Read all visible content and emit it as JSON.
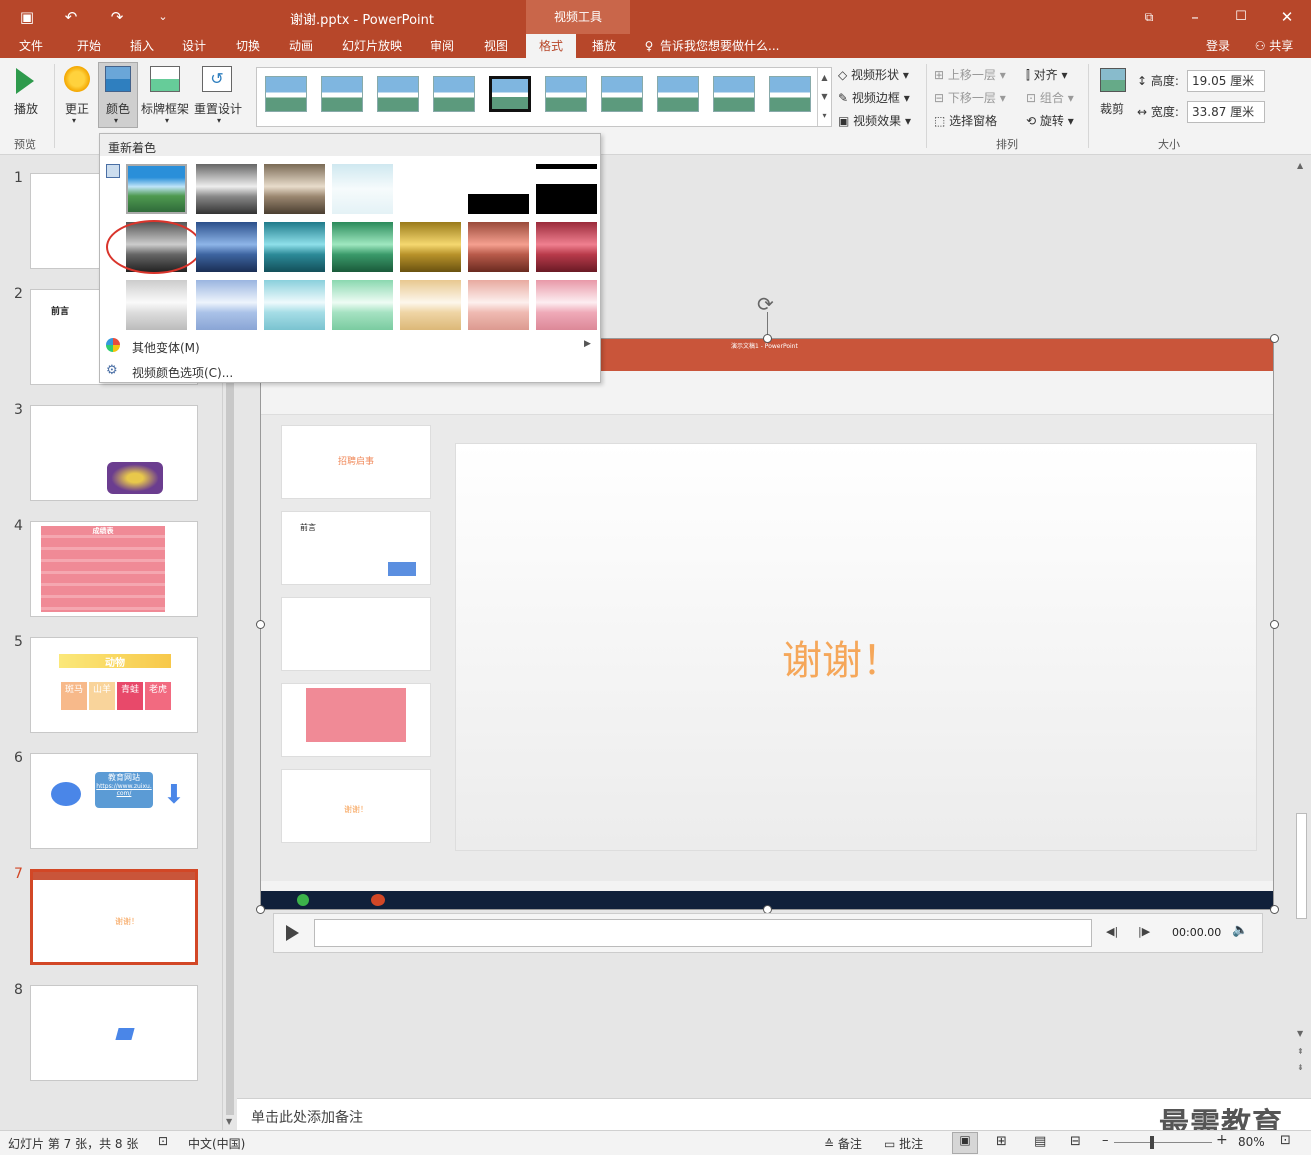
{
  "titlebar": {
    "title": "谢谢.pptx - PowerPoint",
    "context_tab": "视频工具",
    "login": "登录",
    "share": "共享"
  },
  "tabs": [
    "文件",
    "开始",
    "插入",
    "设计",
    "切换",
    "动画",
    "幻灯片放映",
    "审阅",
    "视图",
    "格式",
    "播放"
  ],
  "active_tab": "格式",
  "search_placeholder": "告诉我您想要做什么...",
  "ribbon": {
    "play": "播放",
    "preview_group": "预览",
    "corrections": "更正",
    "color": "颜色",
    "poster_frame": "标牌框架",
    "reset_design": "重置设计",
    "video_shape": "视频形状",
    "video_border": "视频边框",
    "video_effects": "视频效果",
    "bring_forward": "上移一层",
    "send_backward": "下移一层",
    "selection_pane": "选择窗格",
    "align": "对齐",
    "group": "组合",
    "rotate": "旋转",
    "arrange_group": "排列",
    "crop": "裁剪",
    "height_label": "高度:",
    "height_value": "19.05 厘米",
    "width_label": "宽度:",
    "width_value": "33.87 厘米",
    "size_group": "大小"
  },
  "dropdown": {
    "header": "重新着色",
    "more_variations": "其他变体(M)",
    "video_color_options": "视频颜色选项(C)..."
  },
  "slides": [
    {
      "num": "1"
    },
    {
      "num": "2",
      "text": "前言"
    },
    {
      "num": "3"
    },
    {
      "num": "4",
      "text": "成绩表"
    },
    {
      "num": "5",
      "text": "动物",
      "cells": [
        "斑马",
        "山羊",
        "青蛙",
        "老虎"
      ]
    },
    {
      "num": "6",
      "text": "教育网站",
      "link": "https://www.zuixu.com/"
    },
    {
      "num": "7",
      "text": "谢谢！"
    },
    {
      "num": "8"
    }
  ],
  "slide_content": {
    "main_text": "谢谢！",
    "inner_title": "演示文稿1 - PowerPoint",
    "inner_thumbs": [
      "招聘启事",
      "前言",
      "",
      "",
      "谢谢！"
    ]
  },
  "player": {
    "time": "00:00.00"
  },
  "notes_placeholder": "单击此处添加备注",
  "status": {
    "slide_info": "幻灯片 第 7 张，共 8 张",
    "language": "中文(中国)",
    "notes": "备注",
    "comments": "批注",
    "zoom": "80%"
  },
  "watermark": "最需教育"
}
